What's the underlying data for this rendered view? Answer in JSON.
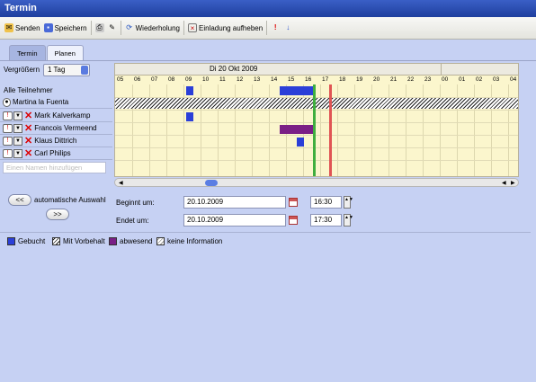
{
  "window": {
    "title": "Termin"
  },
  "toolbar": {
    "send": "Senden",
    "save": "Speichern",
    "recurrence": "Wiederholung",
    "cancel_invite": "Einladung aufheben"
  },
  "tabs": [
    {
      "label": "Termin"
    },
    {
      "label": "Planen"
    }
  ],
  "zoom": {
    "label": "Vergrößern",
    "value": "1 Tag"
  },
  "schedule": {
    "date": "Di 20 Okt 2009",
    "hours": [
      "05",
      "06",
      "07",
      "08",
      "09",
      "10",
      "11",
      "12",
      "13",
      "14",
      "15",
      "16",
      "17",
      "18",
      "19",
      "20",
      "21",
      "22",
      "23",
      "00",
      "01",
      "02",
      "03",
      "04"
    ]
  },
  "participants": {
    "all_label": "Alle Teilnehmer",
    "organizer": "Martina la Fuenta",
    "list": [
      {
        "name": "Mark Kalverkamp"
      },
      {
        "name": "Francois Vermeend"
      },
      {
        "name": "Klaus Dittrich"
      },
      {
        "name": "Carl Philips"
      }
    ],
    "add_placeholder": "Einen Namen hinzufügen"
  },
  "auto_select": {
    "prev": "<<",
    "label": "automatische Auswahl",
    "next": ">>"
  },
  "begin": {
    "label": "Beginnt um:",
    "date": "20.10.2009",
    "time": "16:30"
  },
  "end": {
    "label": "Endet um:",
    "date": "20.10.2009",
    "time": "17:30"
  },
  "legend": [
    {
      "label": "Gebucht",
      "color": "#2b3fd8"
    },
    {
      "label": "Mit Vorbehalt",
      "color": "hatch"
    },
    {
      "label": "abwesend",
      "color": "#7a1f86"
    },
    {
      "label": "keine Information",
      "color": "hatch-light"
    }
  ],
  "colors": {
    "busy": "#2b3fd8",
    "out": "#7a1f86",
    "start_line": "#3fae3f",
    "end_line": "#e05454"
  }
}
